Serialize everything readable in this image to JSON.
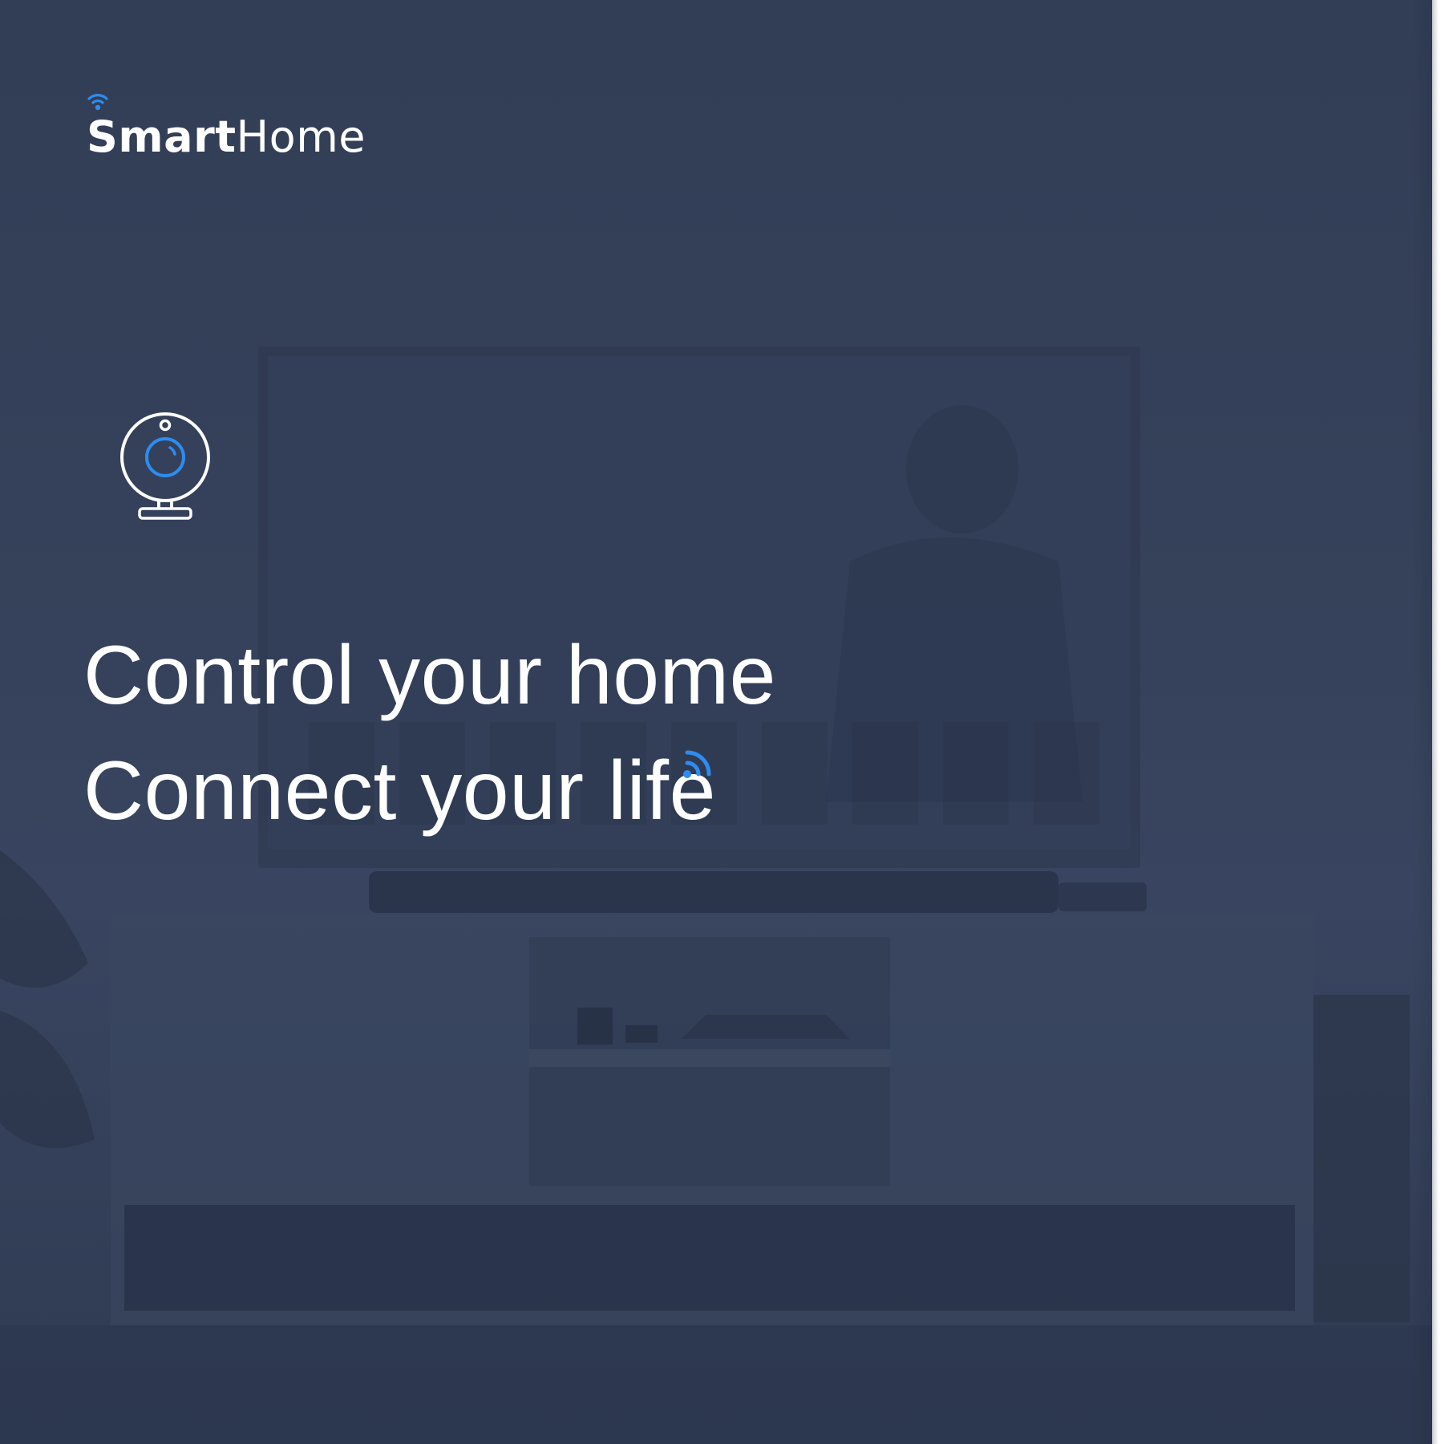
{
  "brand": {
    "name_bold": "Smart",
    "name_light": "Home"
  },
  "hero": {
    "line1": "Control your home",
    "line2": "Connect your life"
  },
  "icons": {
    "logo": "wifi-signal-icon",
    "feature": "webcam-icon",
    "accent": "wifi-signal-icon"
  },
  "colors": {
    "background": "#35415a",
    "text": "#ffffff",
    "accent": "#2d8cf0"
  }
}
